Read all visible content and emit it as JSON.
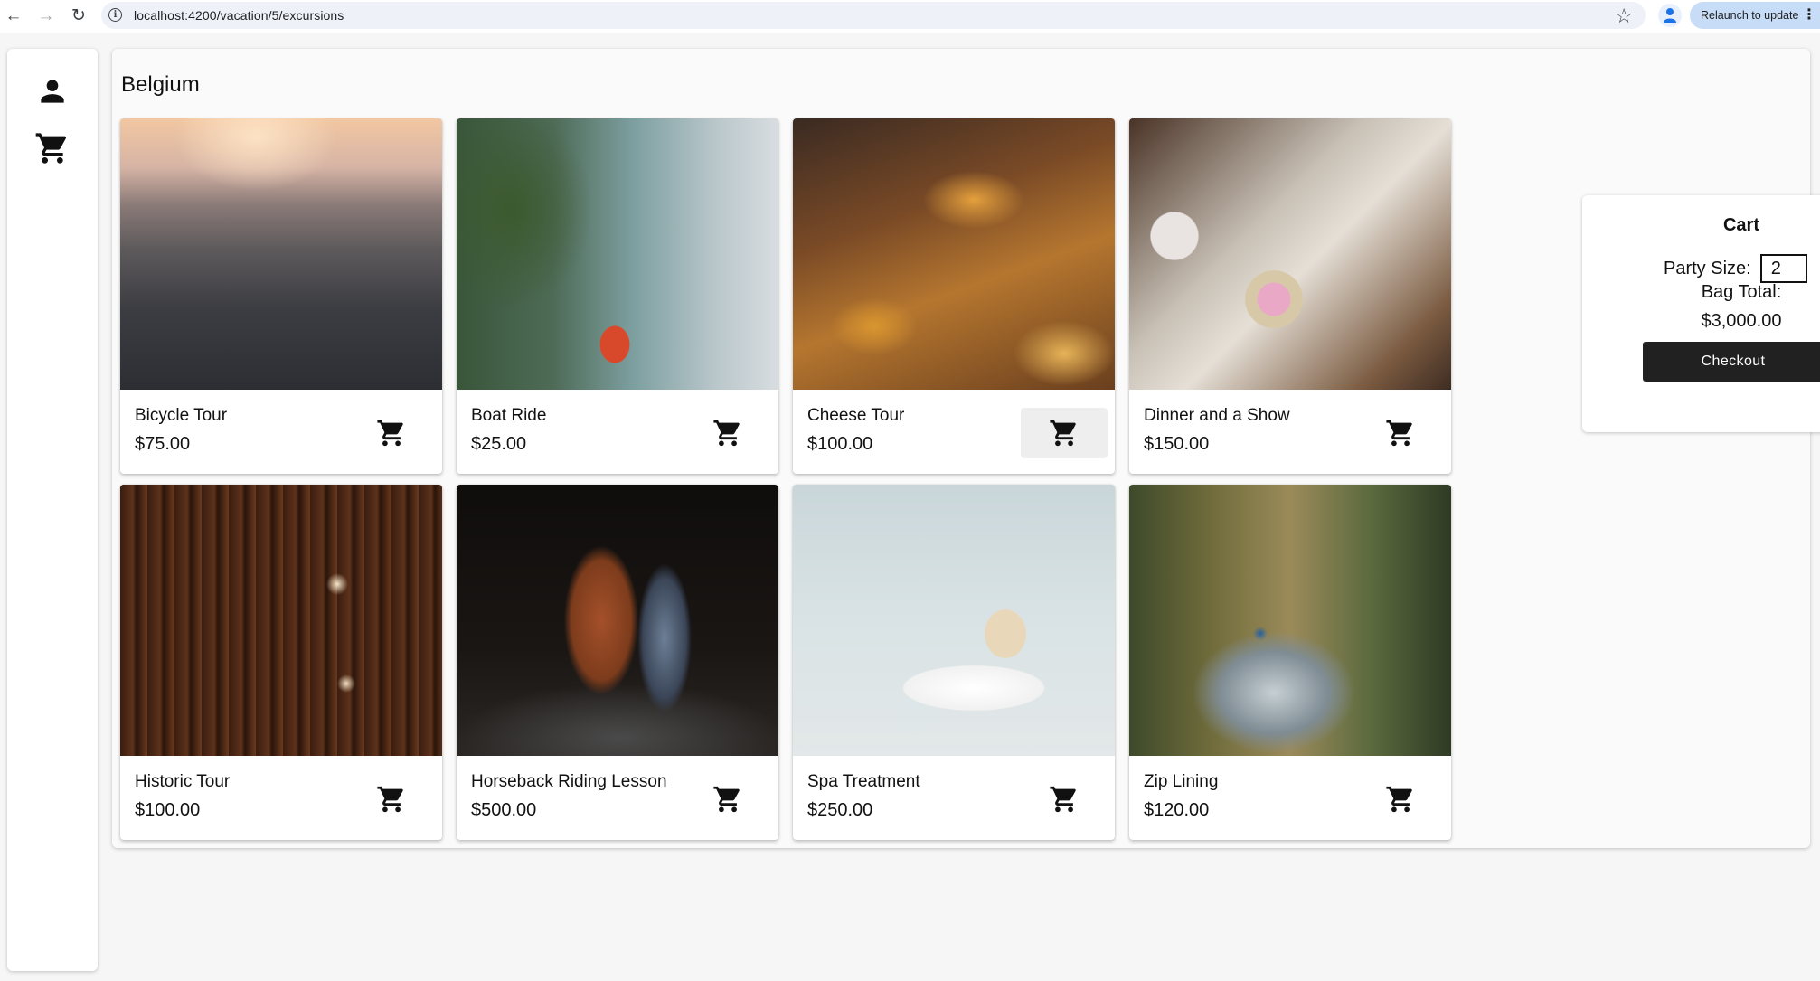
{
  "browser": {
    "url": "localhost:4200/vacation/5/excursions",
    "relaunch_label": "Relaunch to update"
  },
  "page": {
    "title": "Belgium"
  },
  "excursions": [
    {
      "name": "Bicycle Tour",
      "price": "$75.00"
    },
    {
      "name": "Boat Ride",
      "price": "$25.00"
    },
    {
      "name": "Cheese Tour",
      "price": "$100.00"
    },
    {
      "name": "Dinner and a Show",
      "price": "$150.00"
    },
    {
      "name": "Historic Tour",
      "price": "$100.00"
    },
    {
      "name": "Horseback Riding Lesson",
      "price": "$500.00"
    },
    {
      "name": "Spa Treatment",
      "price": "$250.00"
    },
    {
      "name": "Zip Lining",
      "price": "$120.00"
    }
  ],
  "cart": {
    "title": "Cart",
    "party_size_label": "Party Size:",
    "party_size_value": "2",
    "bag_total_label": "Bag Total:",
    "bag_total_value": "$3,000.00",
    "checkout_label": "Checkout"
  },
  "icons": {
    "sidebar": [
      "person-icon",
      "shopping-cart-icon"
    ],
    "card_action": "add-shopping-cart-icon"
  },
  "colors": {
    "checkout_bg": "#212121",
    "page_bg": "#fafafa",
    "card_bg": "#ffffff"
  }
}
